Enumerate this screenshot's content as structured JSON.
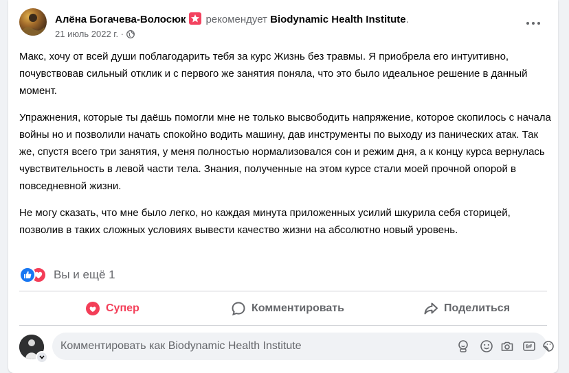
{
  "post": {
    "author": "Алёна Богачева-Волосюк",
    "recommends_text": "рекомендует",
    "page_name": "Biodynamic Health Institute",
    "dot": ".",
    "date": "21 июль 2022 г. ·",
    "paragraphs": [
      "Макс, хочу от всей души поблагодарить тебя за курс Жизнь без травмы. Я приобрела его интуитивно, почувствовав сильный отклик и с первого же занятия поняла, что это было идеальное решение в данный момент.",
      "Упражнения, которые ты даёшь помогли мне не только высвободить напряжение, которое скопилось с начала войны но и позволили начать спокойно водить машину, дав инструменты по выходу из панических атак. Так же, спустя всего три занятия, у меня полностью нормализовался сон и режим дня, а к концу курса вернулась чувствительность в левой части тела. Знания, полученные на этом курсе стали моей прочной опорой в повседневной жизни.",
      "Не могу сказать, что мне было легко, но каждая минута приложенных усилий шкурила себя сторицей, позволив в таких сложных условиях вывести качество жизни на абсолютно новый уровень."
    ]
  },
  "reactions": {
    "summary": "Вы и ещё 1"
  },
  "actions": {
    "super": "Супер",
    "comment": "Комментировать",
    "share": "Поделиться"
  },
  "comment_input": {
    "placeholder": "Комментировать как Biodynamic Health Institute"
  },
  "colors": {
    "accent_blue": "#1877f2",
    "love_red": "#f33e58",
    "secondary_text": "#65676b"
  },
  "icons": [
    "globe-icon",
    "more-icon",
    "like-reaction-icon",
    "love-reaction-icon",
    "heart-icon",
    "comment-icon",
    "share-icon",
    "avatar-sticker-icon",
    "emoji-icon",
    "camera-icon",
    "gif-icon",
    "sticker-icon"
  ]
}
